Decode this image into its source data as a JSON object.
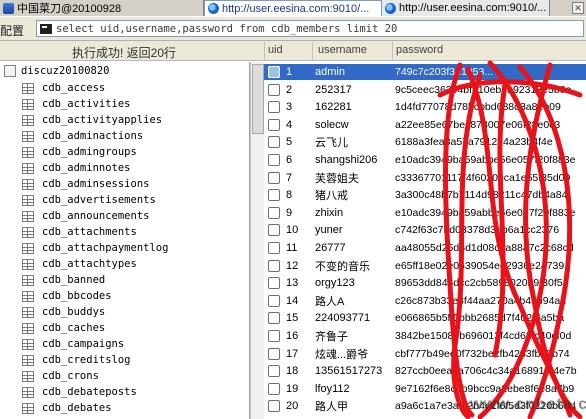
{
  "tabs": [
    {
      "label": "中国菜刀@20100928"
    },
    {
      "label": "http://user.eesina.com:9010/..."
    },
    {
      "label": "http://user.eesina.com:9010/..."
    },
    {
      "label": ""
    }
  ],
  "sqlbar": {
    "label": "配置",
    "query": "select uid,username,password from cdb_members limit 20"
  },
  "status": "执行成功! 返回20行",
  "columns": {
    "uid": "uid",
    "username": "username",
    "password": "password"
  },
  "tree": {
    "root": "discuz20100820",
    "items": [
      "cdb_access",
      "cdb_activities",
      "cdb_activityapplies",
      "cdb_adminactions",
      "cdb_admingroups",
      "cdb_adminnotes",
      "cdb_adminsessions",
      "cdb_advertisements",
      "cdb_announcements",
      "cdb_attachments",
      "cdb_attachpaymentlog",
      "cdb_attachtypes",
      "cdb_banned",
      "cdb_bbcodes",
      "cdb_buddys",
      "cdb_caches",
      "cdb_campaigns",
      "cdb_creditslog",
      "cdb_crons",
      "cdb_debateposts",
      "cdb_debates",
      "cdb_failedlogins"
    ]
  },
  "rows": [
    {
      "uid": "1",
      "username": "admin",
      "password": "749c7c203f3e1953..."
    },
    {
      "uid": "2",
      "username": "252317",
      "password": "9c5ceec36394bfe10eb7a92313e5b0e"
    },
    {
      "uid": "3",
      "username": "162281",
      "password": "1d4fd77078d78bcbbd688d3a8eb09"
    },
    {
      "uid": "4",
      "username": "solecw",
      "password": "a22ee85e67bec878007e06f28e0c3"
    },
    {
      "uid": "5",
      "username": "云飞儿",
      "password": "6188a3fea8a57a791214a23b4f4e"
    },
    {
      "uid": "6",
      "username": "shangshi206",
      "password": "e10adc3949ba59abbe56e057f20f883e"
    },
    {
      "uid": "7",
      "username": "芙蓉姐夫",
      "password": "c33367701117f4f6020eca1e55f35d09"
    },
    {
      "uid": "8",
      "username": "猪八戒",
      "password": "3a300c48b7b7114d98211c47db4a84"
    },
    {
      "uid": "9",
      "username": "zhixin",
      "password": "e10adc3949ba59abbe56e057f20f883e"
    },
    {
      "uid": "10",
      "username": "yuner",
      "password": "c742f63c7bd03378d3ab6a1cc2376"
    },
    {
      "uid": "11",
      "username": "26777",
      "password": "aa48055d25d3d1d08c7a88a7c2c68cd"
    },
    {
      "uid": "12",
      "username": "不变的音乐",
      "password": "e65ff18e02e0639054ee2936e24739"
    },
    {
      "uid": "13",
      "username": "orgy123",
      "password": "89653dd846dcc2cb5898020b9f30f5"
    },
    {
      "uid": "14",
      "username": "路人A",
      "password": "c26c873b33e8f44aa270a4b45b94ad"
    },
    {
      "uid": "15",
      "username": "224093771",
      "password": "e066865b5ff5bbb2685d7f402f6a5ba"
    },
    {
      "uid": "16",
      "username": "齐鲁子",
      "password": "3842be1508bb696013f4cd62fc40cf0d"
    },
    {
      "uid": "17",
      "username": "炫魂...爵爷",
      "password": "cbf777b49ee0f732be2fb4263fbe6b74"
    },
    {
      "uid": "18",
      "username": "13561517273",
      "password": "827ccb0eea8a706c4c34a16891f84e7b"
    },
    {
      "uid": "19",
      "username": "lfoy112",
      "password": "9e7162f6e8c5b9bcc9a2ebe8f6e8a7b9"
    },
    {
      "uid": "20",
      "username": "路人甲",
      "password": "a9a6c1a7e3a6f2b4e1f6f5d3f0220b6ed"
    }
  ],
  "watermark": "www.cnbeta.com",
  "colors": {
    "selection": "#3169c6",
    "scribble": "#e8121a",
    "toolbar": "#ece9d8"
  }
}
